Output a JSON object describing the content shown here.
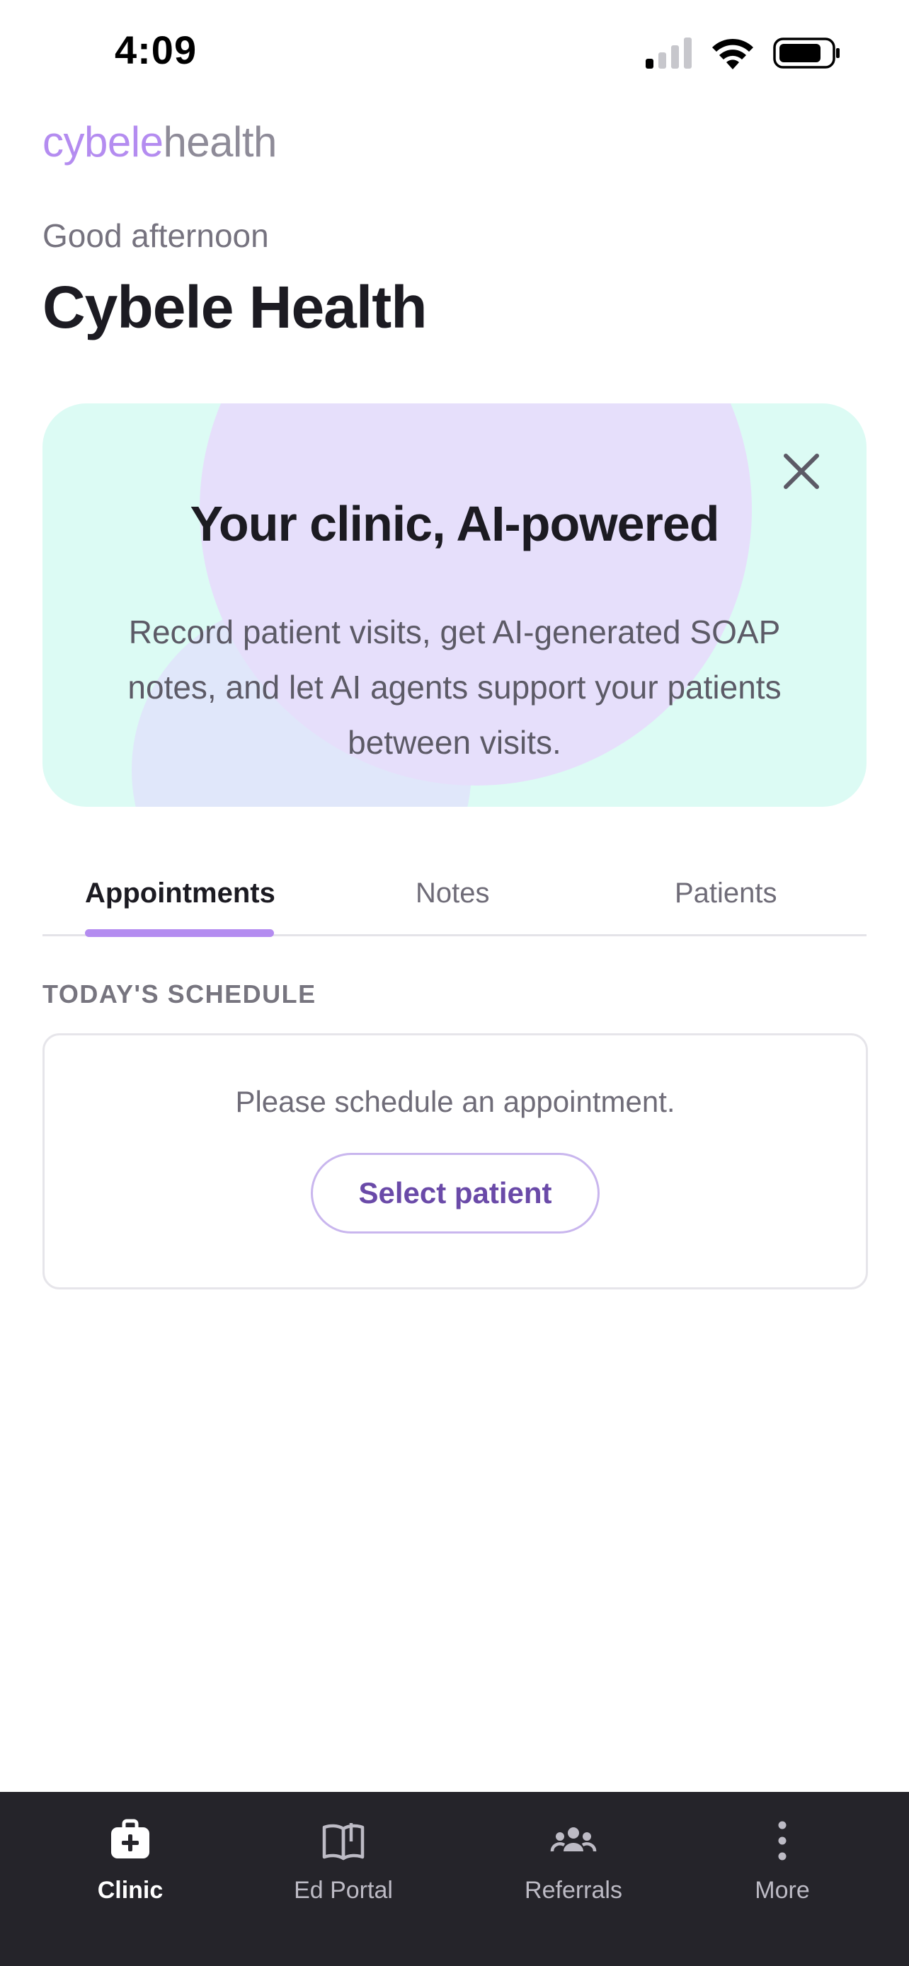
{
  "status_bar": {
    "time": "4:09"
  },
  "brand": {
    "part1": "cybele",
    "part2": "health"
  },
  "header": {
    "greeting": "Good afternoon",
    "clinic_name": "Cybele Health"
  },
  "promo": {
    "title": "Your clinic, AI-powered",
    "body": "Record patient visits, get AI-generated SOAP notes, and let AI agents support your patients between visits."
  },
  "tabs": [
    {
      "label": "Appointments",
      "active": true
    },
    {
      "label": "Notes",
      "active": false
    },
    {
      "label": "Patients",
      "active": false
    }
  ],
  "schedule": {
    "section_label": "TODAY'S SCHEDULE",
    "empty_text": "Please schedule an appointment.",
    "button_label": "Select patient"
  },
  "bottom_nav": [
    {
      "label": "Clinic",
      "icon": "medical-bag-icon",
      "active": true
    },
    {
      "label": "Ed Portal",
      "icon": "book-open-icon",
      "active": false
    },
    {
      "label": "Referrals",
      "icon": "people-group-icon",
      "active": false
    },
    {
      "label": "More",
      "icon": "more-vertical-icon",
      "active": false
    }
  ],
  "colors": {
    "brand_purple": "#b48cf0",
    "promo_bg": "#dcfbf4",
    "accent_text": "#6a4aa8",
    "nav_bg": "#25242a"
  }
}
